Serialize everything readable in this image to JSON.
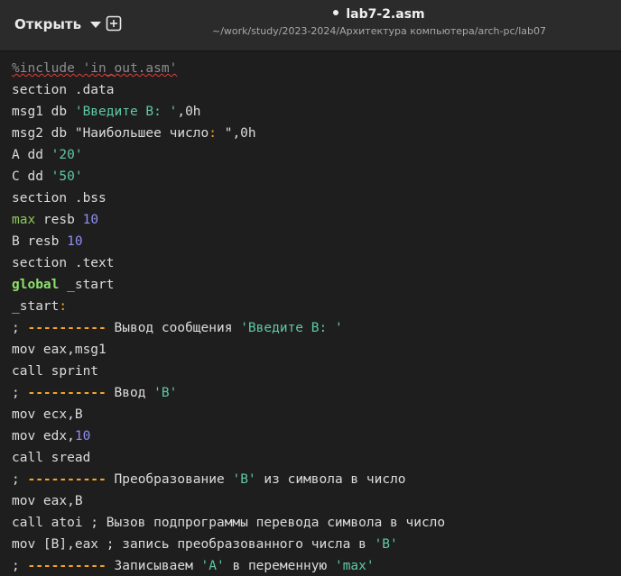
{
  "header": {
    "open_label": "Открыть",
    "file_name": "lab7-2.asm",
    "file_path": "~/work/study/2023-2024/Архитектура компьютера/arch-pc/lab07"
  },
  "code": {
    "l1": "%include 'in_out.asm'",
    "l2": "section .data",
    "l3a": "msg1 db ",
    "l3b": "'Введите B: '",
    "l3c": ",0h",
    "l4a": "msg2 db \"Наибольшее число",
    "l4b": ":",
    "l4c": " \",0h",
    "l5a": "A dd ",
    "l5b": "'20'",
    "l6a": "C dd ",
    "l6b": "'50'",
    "l7": "section .bss",
    "l8a": "max",
    "l8b": " resb ",
    "l8c": "10",
    "l9a": "B resb ",
    "l9b": "10",
    "l10": "section .text",
    "l11a": "global",
    "l11b": " _start",
    "l12a": "_start",
    "l12b": ":",
    "l13a": "; ",
    "l13b": "----------",
    "l13c": " Вывод сообщения ",
    "l13d": "'Введите B: '",
    "l14": "mov eax,msg1",
    "l15": "call sprint",
    "l16a": "; ",
    "l16b": "----------",
    "l16c": " Ввод ",
    "l16d": "'B'",
    "l17": "mov ecx,B",
    "l18a": "mov edx,",
    "l18b": "10",
    "l19": "call sread",
    "l20a": "; ",
    "l20b": "----------",
    "l20c": " Преобразование ",
    "l20d": "'B'",
    "l20e": " из символа в число",
    "l21": "mov eax,B",
    "l22": "call atoi ; Вызов подпрограммы перевода символа в число",
    "l23a": "mov [B],eax ; запись преобразованного числа в ",
    "l23b": "'B'",
    "l24a": "; ",
    "l24b": "----------",
    "l24c": " Записываем ",
    "l24d": "'A'",
    "l24e": " в переменную ",
    "l24f": "'max'"
  }
}
